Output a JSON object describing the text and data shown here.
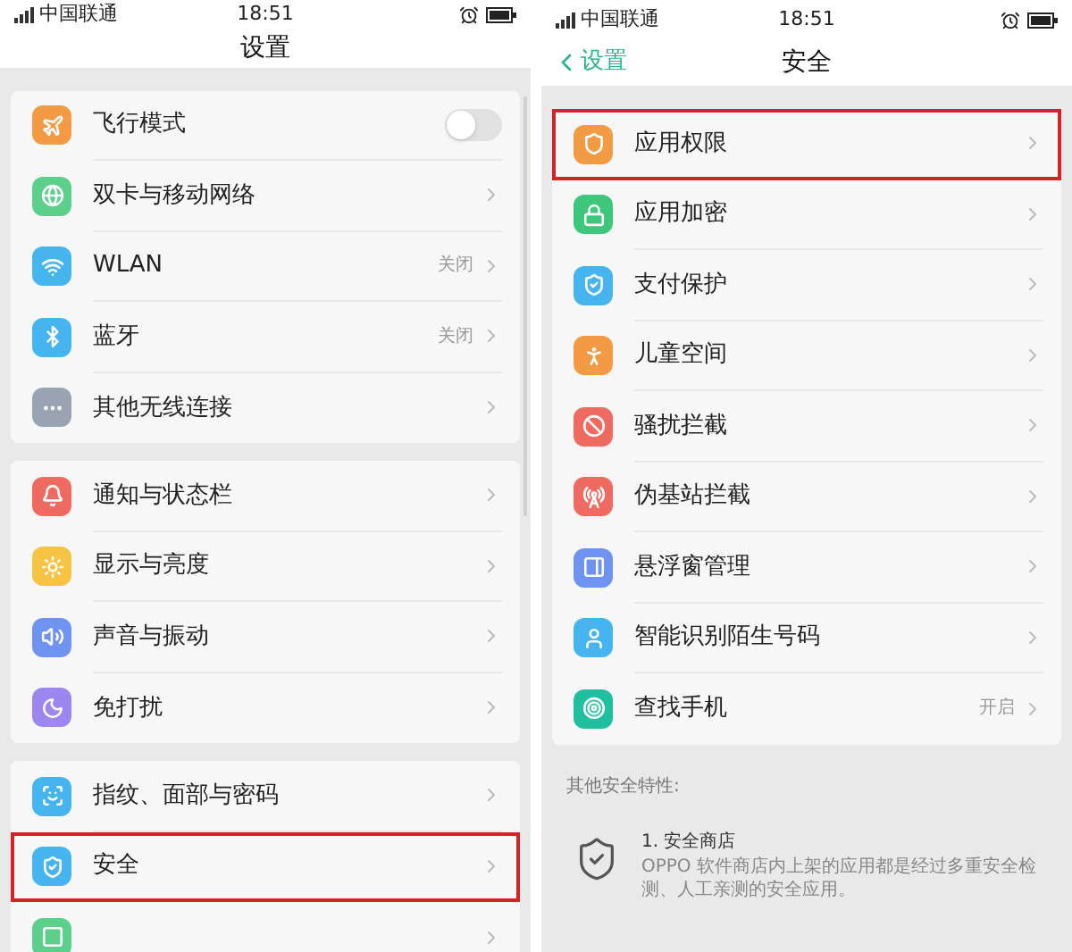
{
  "screens": [
    {
      "status_bar": {
        "carrier": "中国联通",
        "time": "18:51"
      },
      "title": "设置",
      "groups": [
        [
          {
            "kind": "toggle",
            "label": "飞行模式",
            "on": false,
            "highlighted": false
          },
          {
            "kind": "link",
            "label": "双卡与移动网络",
            "highlighted": false
          },
          {
            "kind": "link",
            "label": "WLAN",
            "value": "关闭",
            "highlighted": false
          },
          {
            "kind": "link",
            "label": "蓝牙",
            "value": "关闭",
            "highlighted": false
          },
          {
            "kind": "link",
            "label": "其他无线连接",
            "highlighted": false
          }
        ],
        [
          {
            "kind": "link",
            "label": "通知与状态栏",
            "highlighted": false
          },
          {
            "kind": "link",
            "label": "显示与亮度",
            "highlighted": false
          },
          {
            "kind": "link",
            "label": "声音与振动",
            "highlighted": false
          },
          {
            "kind": "link",
            "label": "免打扰",
            "highlighted": false
          }
        ],
        [
          {
            "kind": "link",
            "label": "指纹、面部与密码",
            "highlighted": false
          },
          {
            "kind": "link",
            "label": "安全",
            "highlighted": true
          },
          {
            "kind": "link",
            "highlighted": false
          }
        ]
      ]
    },
    {
      "status_bar": {
        "carrier": "中国联通",
        "time": "18:51"
      },
      "back": "设置",
      "title": "安全",
      "groups": [
        [
          {
            "kind": "link",
            "label": "应用权限",
            "highlighted": true
          },
          {
            "kind": "link",
            "label": "应用加密",
            "highlighted": false
          },
          {
            "kind": "link",
            "label": "支付保护",
            "highlighted": false
          },
          {
            "kind": "link",
            "label": "儿童空间",
            "highlighted": false
          },
          {
            "kind": "link",
            "label": "骚扰拦截",
            "highlighted": false
          },
          {
            "kind": "link",
            "label": "伪基站拦截",
            "highlighted": false
          },
          {
            "kind": "link",
            "label": "悬浮窗管理",
            "highlighted": false
          },
          {
            "kind": "link",
            "label": "智能识别陌生号码",
            "highlighted": false
          },
          {
            "kind": "link",
            "label": "查找手机",
            "value": "开启",
            "highlighted": false
          }
        ]
      ],
      "section_header": "其他安全特性:",
      "features": [
        {
          "title": "1. 安全商店",
          "description": "OPPO 软件商店内上架的应用都是经过多重安全检测、人工亲测的安全应用。"
        }
      ]
    }
  ]
}
